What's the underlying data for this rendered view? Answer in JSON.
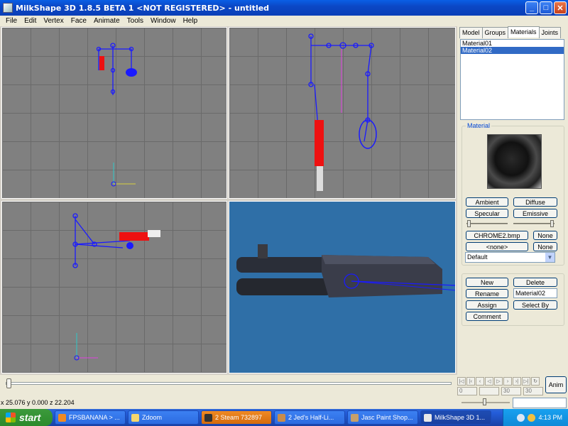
{
  "window": {
    "title": "MilkShape 3D 1.8.5 BETA 1 <NOT REGISTERED> - untitled",
    "minimize": "_",
    "maximize": "□",
    "close": "✕"
  },
  "menu": [
    "File",
    "Edit",
    "Vertex",
    "Face",
    "Animate",
    "Tools",
    "Window",
    "Help"
  ],
  "tabs": [
    "Model",
    "Groups",
    "Materials",
    "Joints"
  ],
  "active_tab": "Materials",
  "materials": {
    "list": [
      "Material01",
      "Material02"
    ],
    "selected": "Material02",
    "group_label": "Material",
    "ambient": "Ambient",
    "diffuse": "Diffuse",
    "specular": "Specular",
    "emissive": "Emissive",
    "texture": "CHROME2.bmp",
    "none1": "None",
    "alpha_map": "<none>",
    "none2": "None",
    "mode": "Default",
    "new": "New",
    "delete": "Delete",
    "rename": "Rename",
    "name_value": "Material02",
    "assign": "Assign",
    "select_by": "Select By",
    "comment": "Comment"
  },
  "timeline": {
    "frame_start": "0",
    "frame_mid": "30",
    "frame_end": "30",
    "anim": "Anim"
  },
  "status": {
    "coords": "x 25.076 y 0.000 z 22.204"
  },
  "taskbar": {
    "start": "start",
    "tasks": [
      {
        "label": "FPSBANANA > ...",
        "state": "normal"
      },
      {
        "label": "Zdoom",
        "state": "normal"
      },
      {
        "label": "2 Steam 732897",
        "state": "alert"
      },
      {
        "label": "2 Jed's Half-Li...",
        "state": "normal"
      },
      {
        "label": "Jasc Paint Shop...",
        "state": "normal"
      },
      {
        "label": "MilkShape 3D 1...",
        "state": "active"
      }
    ],
    "clock": "4:13 PM"
  }
}
